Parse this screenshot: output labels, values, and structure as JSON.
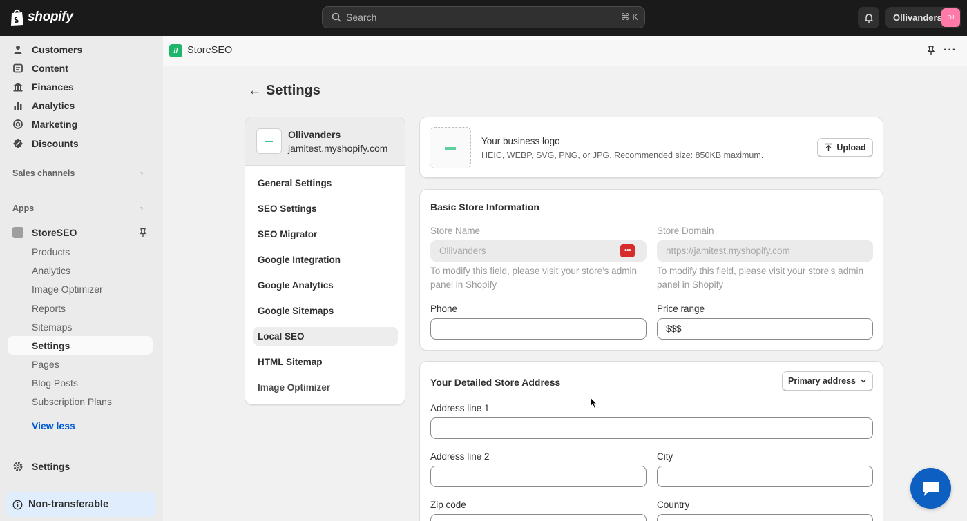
{
  "topbar": {
    "brand": "shopify",
    "search_placeholder": "Search",
    "search_shortcut": "⌘ K",
    "store_name": "Ollivanders",
    "store_avatar": "Oll"
  },
  "sidebar": {
    "items": [
      {
        "label": "Customers",
        "icon": "person-icon"
      },
      {
        "label": "Content",
        "icon": "content-icon"
      },
      {
        "label": "Finances",
        "icon": "bank-icon"
      },
      {
        "label": "Analytics",
        "icon": "bar-chart-icon"
      },
      {
        "label": "Marketing",
        "icon": "target-icon"
      },
      {
        "label": "Discounts",
        "icon": "discount-icon"
      }
    ],
    "sales_channels": "Sales channels",
    "apps": "Apps",
    "app_name": "StoreSEO",
    "sub_items": [
      "Products",
      "Analytics",
      "Image Optimizer",
      "Reports",
      "Sitemaps",
      "Settings",
      "Pages",
      "Blog Posts",
      "Subscription Plans"
    ],
    "view_less": "View less",
    "settings": "Settings",
    "non_transferable": "Non-transferable"
  },
  "app_header": {
    "title": "StoreSEO"
  },
  "page": {
    "title": "Settings"
  },
  "settings_nav": {
    "store_name": "Ollivanders",
    "store_domain": "jamitest.myshopify.com",
    "items": [
      "General Settings",
      "SEO Settings",
      "SEO Migrator",
      "Google Integration",
      "Google Analytics",
      "Google Sitemaps",
      "Local SEO",
      "HTML Sitemap",
      "Image Optimizer"
    ],
    "active": "Local SEO"
  },
  "business_logo": {
    "title": "Your business logo",
    "subtitle": "HEIC, WEBP, SVG, PNG, or JPG. Recommended size: 850KB maximum.",
    "upload_label": "Upload"
  },
  "basic_info": {
    "title": "Basic Store Information",
    "store_name_label": "Store Name",
    "store_name_value": "Ollivanders",
    "store_domain_label": "Store Domain",
    "store_domain_value": "https://jamitest.myshopify.com",
    "help_text": "To modify this field, please visit your store's admin panel in Shopify",
    "phone_label": "Phone",
    "phone_value": "",
    "price_range_label": "Price range",
    "price_range_value": "$$$"
  },
  "address": {
    "title": "Your Detailed Store Address",
    "primary_button": "Primary address",
    "line1_label": "Address line 1",
    "line2_label": "Address line 2",
    "city_label": "City",
    "zip_label": "Zip code",
    "country_label": "Country"
  },
  "colors": {
    "accent": "#005bd3",
    "app_green": "#1fb66b",
    "chat": "#0e5fc2"
  }
}
